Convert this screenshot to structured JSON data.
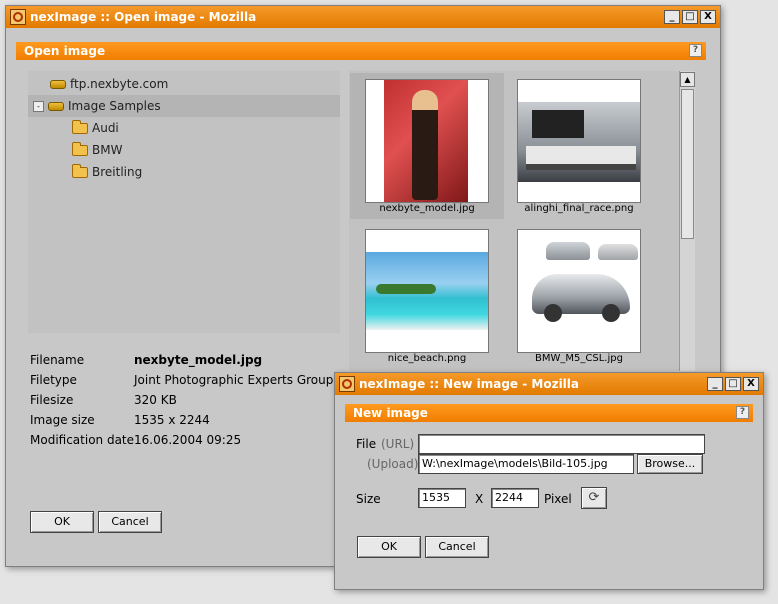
{
  "open_window": {
    "title": "nexImage :: Open image - Mozilla",
    "window_buttons": [
      "_",
      "□",
      "X"
    ],
    "dialog_header": "Open image",
    "help": "?",
    "tree": [
      {
        "label": "ftp.nexbyte.com",
        "type": "drive",
        "expanded": false
      },
      {
        "label": "Image Samples",
        "type": "drive",
        "expanded": true
      },
      {
        "label": "Audi",
        "type": "folder"
      },
      {
        "label": "BMW",
        "type": "folder"
      },
      {
        "label": "Breitling",
        "type": "folder"
      }
    ],
    "tree_toggle": "-",
    "thumbnails": [
      {
        "label": "nexbyte_model.jpg",
        "selected": true
      },
      {
        "label": "alinghi_final_race.png"
      },
      {
        "label": "nice_beach.png"
      },
      {
        "label": "BMW_M5_CSL.jpg"
      }
    ],
    "info": {
      "filename_label": "Filename",
      "filename": "nexbyte_model.jpg",
      "filetype_label": "Filetype",
      "filetype": "Joint Photographic Experts Group",
      "filesize_label": "Filesize",
      "filesize": "320 KB",
      "imagesize_label": "Image size",
      "imagesize": "1535 x 2244",
      "moddate_label": "Modification date",
      "moddate": "16.06.2004 09:25"
    },
    "ok_label": "OK",
    "cancel_label": "Cancel"
  },
  "new_window": {
    "title": "nexImage :: New image - Mozilla",
    "window_buttons": [
      "_",
      "□",
      "X"
    ],
    "dialog_header": "New image",
    "help": "?",
    "file_label": "File",
    "url_label": "(URL)",
    "upload_label": "(Upload)",
    "url_value": "",
    "upload_value": "W:\\nexImage\\models\\Bild-105.jpg",
    "browse_label": "Browse...",
    "size_label": "Size",
    "width_value": "1535",
    "x_label": "X",
    "height_value": "2244",
    "pixel_label": "Pixel",
    "ok_label": "OK",
    "cancel_label": "Cancel"
  },
  "colors": {
    "accent": "#f08a00",
    "panel": "#c8c8c8"
  }
}
